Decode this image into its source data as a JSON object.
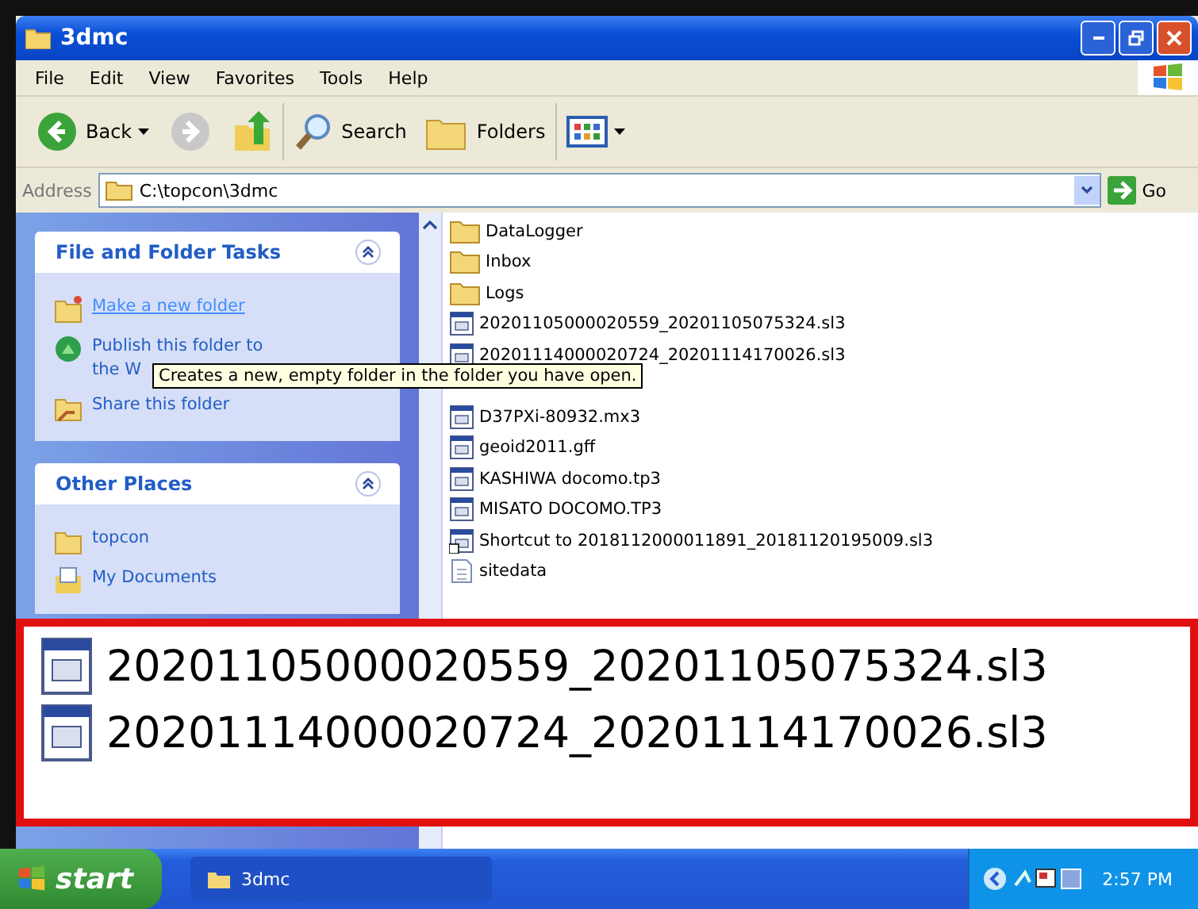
{
  "window": {
    "title": "3dmc"
  },
  "menu": [
    "File",
    "Edit",
    "View",
    "Favorites",
    "Tools",
    "Help"
  ],
  "toolbar": [
    {
      "kind": "back",
      "label": "Back"
    },
    {
      "kind": "forward"
    },
    {
      "kind": "up"
    },
    {
      "kind": "search",
      "label": "Search"
    },
    {
      "kind": "folders",
      "label": "Folders"
    },
    {
      "kind": "views"
    }
  ],
  "address": {
    "label": "Address",
    "value": "C:\\topcon\\3dmc",
    "go": "Go"
  },
  "sidebar": [
    {
      "title": "File and Folder Tasks",
      "items": [
        {
          "kind": "newfolder",
          "label": "Make a new folder",
          "hovered": true
        },
        {
          "kind": "publish",
          "label": "Publish this folder to the W",
          "hovered": false
        },
        {
          "kind": "share",
          "label": "Share this folder",
          "hovered": false
        }
      ]
    },
    {
      "title": "Other Places",
      "items": [
        {
          "kind": "folder",
          "label": "topcon",
          "hovered": false
        },
        {
          "kind": "docs",
          "label": "My Documents",
          "hovered": false
        }
      ]
    }
  ],
  "files": [
    {
      "kind": "folder",
      "name": "DataLogger"
    },
    {
      "kind": "folder",
      "name": "Inbox"
    },
    {
      "kind": "folder",
      "name": "Logs"
    },
    {
      "kind": "file",
      "name": "20201105000020559_20201105075324.sl3"
    },
    {
      "kind": "file",
      "name": "20201114000020724_20201114170026.sl3"
    },
    {
      "kind": "file",
      "name": "D37PXi-80932.mx3"
    },
    {
      "kind": "file",
      "name": "geoid2011.gff"
    },
    {
      "kind": "file",
      "name": "KASHIWA docomo.tp3"
    },
    {
      "kind": "file",
      "name": "MISATO DOCOMO.TP3"
    },
    {
      "kind": "shortcut",
      "name": "Shortcut to 2018112000011891_20181120195009.sl3"
    },
    {
      "kind": "text",
      "name": "sitedata"
    }
  ],
  "tooltip": "Creates a new, empty folder in the folder you have open.",
  "inset": [
    "20201105000020559_20201105075324.sl3",
    "20201114000020724_20201114170026.sl3"
  ],
  "taskbar": {
    "start": "start",
    "task": "3dmc",
    "clock": "2:57 PM"
  }
}
